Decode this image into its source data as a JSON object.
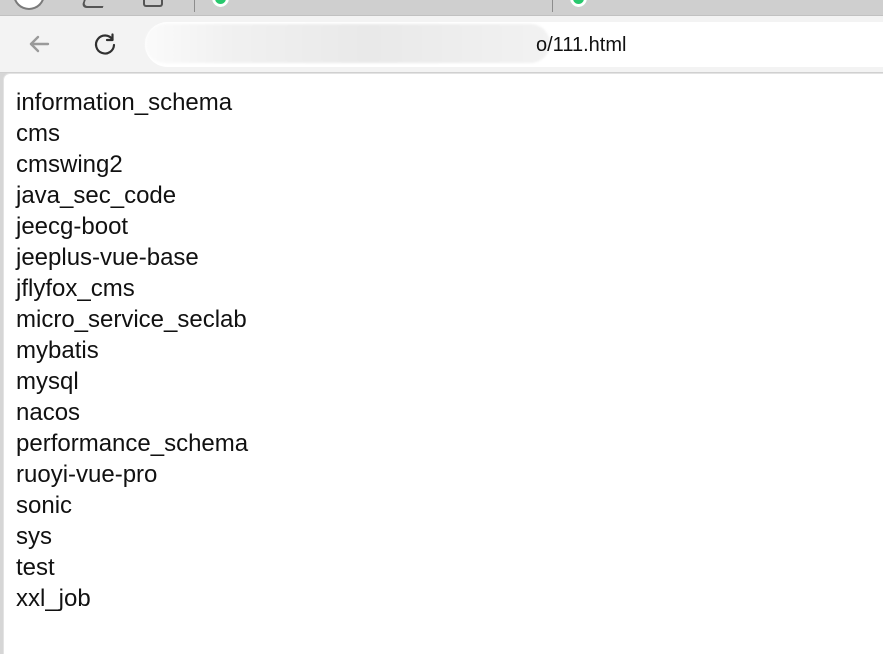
{
  "browser": {
    "address": {
      "visible_url_suffix": "o/111.html"
    },
    "icons": {
      "back": "back-arrow-icon",
      "reload": "reload-icon"
    }
  },
  "page": {
    "lines": [
      "information_schema",
      "cms",
      "cmswing2",
      "java_sec_code",
      "jeecg-boot",
      "jeeplus-vue-base",
      "jflyfox_cms",
      "micro_service_seclab",
      "mybatis",
      "mysql",
      "nacos",
      "performance_schema",
      "ruoyi-vue-pro",
      "sonic",
      "sys",
      "test",
      "xxl_job"
    ]
  },
  "colors": {
    "tab_strip": "#cfcfcf",
    "toolbar": "#f3f3f3",
    "page_background": "#ffffff",
    "text": "#111111",
    "favicon_green": "#27c86d"
  }
}
